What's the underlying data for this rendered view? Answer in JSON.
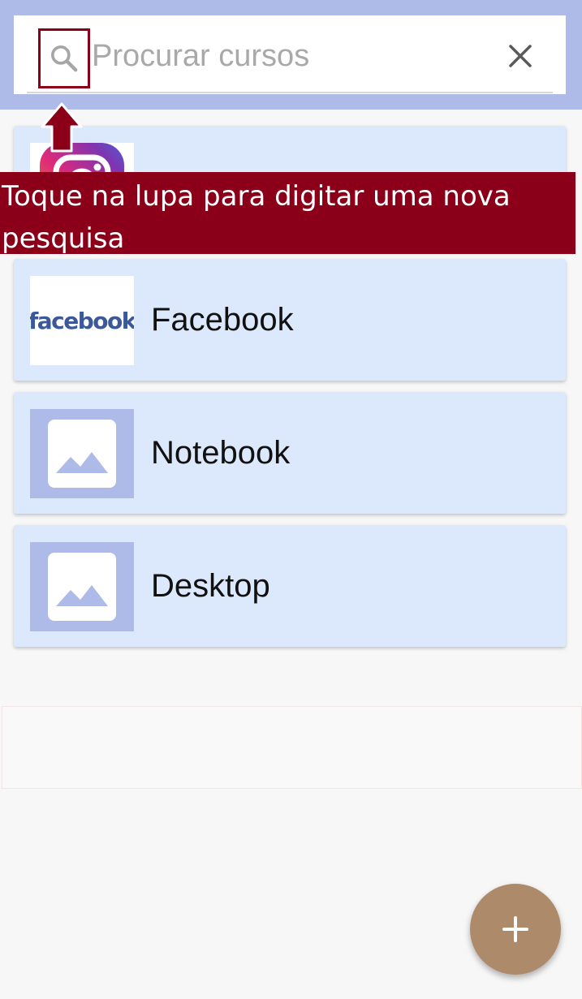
{
  "search": {
    "placeholder": "Procurar cursos",
    "value": "",
    "search_icon": "search-icon",
    "clear_icon": "close-icon"
  },
  "tooltip": {
    "text": "Toque na lupa para digitar uma nova pesquisa",
    "color": "#8b0018"
  },
  "courses": [
    {
      "label": "",
      "thumb": "instagram-logo"
    },
    {
      "label": "Facebook",
      "thumb": "facebook-logo",
      "logo_text": "facebook"
    },
    {
      "label": "Notebook",
      "thumb": "image-placeholder-icon"
    },
    {
      "label": "Desktop",
      "thumb": "image-placeholder-icon"
    }
  ],
  "fab": {
    "icon": "plus-icon",
    "color": "#ad8b6a"
  },
  "colors": {
    "header": "#aebbe8",
    "card": "#dce8fb",
    "highlight": "#8b0018"
  }
}
